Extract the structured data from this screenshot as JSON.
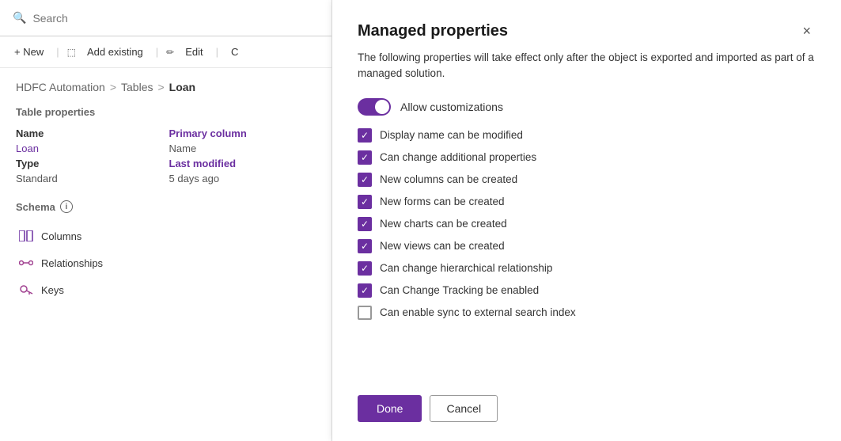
{
  "search": {
    "placeholder": "Search",
    "value": ""
  },
  "toolbar": {
    "new_label": "+ New",
    "add_existing_label": "Add existing",
    "edit_label": "Edit",
    "more_label": "C"
  },
  "breadcrumb": {
    "part1": "HDFC Automation",
    "sep1": ">",
    "part2": "Tables",
    "sep2": ">",
    "current": "Loan"
  },
  "table_properties": {
    "title": "Table properties",
    "name_label": "Name",
    "name_value": "Loan",
    "primary_column_label": "Primary column",
    "primary_column_value": "Name",
    "type_label": "Type",
    "type_value": "Standard",
    "last_modified_label": "Last modified",
    "last_modified_value": "5 days ago"
  },
  "schema": {
    "title": "Schema",
    "items": [
      {
        "label": "Columns",
        "icon": "columns"
      },
      {
        "label": "Relationships",
        "icon": "relationships"
      },
      {
        "label": "Keys",
        "icon": "keys"
      }
    ]
  },
  "modal": {
    "title": "Managed properties",
    "close_label": "×",
    "description": "The following properties will take effect only after the object is exported and imported as part of a managed solution.",
    "toggle_label": "Allow customizations",
    "checkboxes": [
      {
        "label": "Display name can be modified",
        "checked": true
      },
      {
        "label": "Can change additional properties",
        "checked": true
      },
      {
        "label": "New columns can be created",
        "checked": true
      },
      {
        "label": "New forms can be created",
        "checked": true
      },
      {
        "label": "New charts can be created",
        "checked": true
      },
      {
        "label": "New views can be created",
        "checked": true
      },
      {
        "label": "Can change hierarchical relationship",
        "checked": true
      },
      {
        "label": "Can Change Tracking be enabled",
        "checked": true
      },
      {
        "label": "Can enable sync to external search index",
        "checked": false
      }
    ],
    "done_label": "Done",
    "cancel_label": "Cancel"
  }
}
